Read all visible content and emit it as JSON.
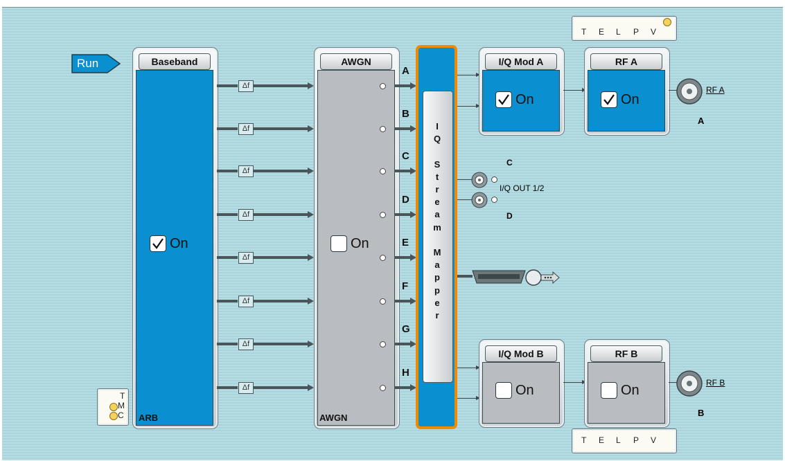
{
  "run": {
    "label": "Run"
  },
  "baseband": {
    "header": "Baseband",
    "on_label": "On",
    "checked": true,
    "footer": "ARB"
  },
  "awgn": {
    "header": "AWGN",
    "on_label": "On",
    "checked": false,
    "footer": "AWGN"
  },
  "stream_letters": [
    "A",
    "B",
    "C",
    "D",
    "E",
    "F",
    "G",
    "H"
  ],
  "delta_label": "Δf",
  "mapper": {
    "letters": [
      "I",
      "Q",
      "",
      "S",
      "t",
      "r",
      "e",
      "a",
      "m",
      "",
      "M",
      "a",
      "p",
      "p",
      "e",
      "r"
    ]
  },
  "iq_mod_a": {
    "header": "I/Q Mod A",
    "on_label": "On",
    "checked": true
  },
  "rf_a": {
    "header": "RF A",
    "on_label": "On",
    "checked": true,
    "connector_label": "RF A",
    "channel": "A"
  },
  "iq_mod_b": {
    "header": "I/Q Mod B",
    "on_label": "On",
    "checked": false
  },
  "rf_b": {
    "header": "RF B",
    "on_label": "On",
    "checked": false,
    "connector_label": "RF B",
    "channel": "B"
  },
  "iq_out": {
    "label": "I/Q OUT 1/2",
    "top": "C",
    "bottom": "D"
  },
  "status_top": {
    "letters": [
      "T",
      "E",
      "L",
      "P",
      "V"
    ]
  },
  "status_bottom": {
    "letters": [
      "T",
      "E",
      "L",
      "P",
      "V"
    ]
  },
  "status_left": {
    "letters": [
      "T",
      "M",
      "C"
    ]
  },
  "colors": {
    "block_blue": "#0a8fd0",
    "mapper_border": "#f08a00",
    "background": "#b6dde3",
    "led": "#f3d25c"
  }
}
